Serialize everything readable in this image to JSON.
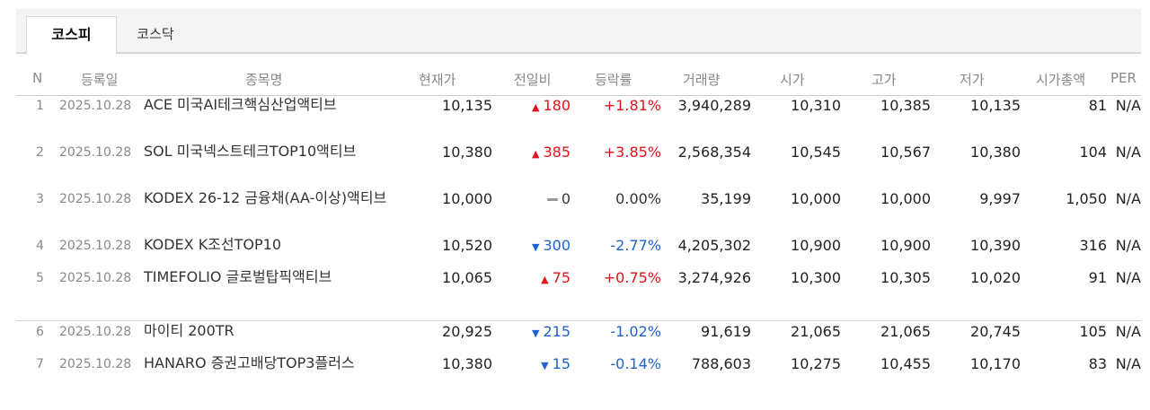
{
  "tabs": [
    {
      "label": "코스피",
      "active": true
    },
    {
      "label": "코스닥",
      "active": false
    }
  ],
  "columns": {
    "no": "N",
    "date": "등록일",
    "name": "종목명",
    "price": "현재가",
    "change": "전일비",
    "rate": "등락률",
    "volume": "거래량",
    "open": "시가",
    "high": "고가",
    "low": "저가",
    "mcap": "시가총액",
    "per": "PER"
  },
  "rows": [
    {
      "no": "1",
      "date": "2025.10.28",
      "name": "ACE 미국AI테크핵심산업액티브",
      "price": "10,135",
      "dir": "up",
      "change": "180",
      "rate": "+1.81%",
      "volume": "3,940,289",
      "open": "10,310",
      "high": "10,385",
      "low": "10,135",
      "mcap": "81",
      "per": "N/A"
    },
    {
      "no": "2",
      "date": "2025.10.28",
      "name": "SOL 미국넥스트테크TOP10액티브",
      "price": "10,380",
      "dir": "up",
      "change": "385",
      "rate": "+3.85%",
      "volume": "2,568,354",
      "open": "10,545",
      "high": "10,567",
      "low": "10,380",
      "mcap": "104",
      "per": "N/A"
    },
    {
      "no": "3",
      "date": "2025.10.28",
      "name": "KODEX 26-12 금융채(AA-이상)액티브",
      "price": "10,000",
      "dir": "flat",
      "change": "0",
      "rate": "0.00%",
      "volume": "35,199",
      "open": "10,000",
      "high": "10,000",
      "low": "9,997",
      "mcap": "1,050",
      "per": "N/A"
    },
    {
      "no": "4",
      "date": "2025.10.28",
      "name": "KODEX K조선TOP10",
      "price": "10,520",
      "dir": "down",
      "change": "300",
      "rate": "-2.77%",
      "volume": "4,205,302",
      "open": "10,900",
      "high": "10,900",
      "low": "10,390",
      "mcap": "316",
      "per": "N/A"
    },
    {
      "no": "5",
      "date": "2025.10.28",
      "name": "TIMEFOLIO 글로벌탑픽액티브",
      "price": "10,065",
      "dir": "up",
      "change": "75",
      "rate": "+0.75%",
      "volume": "3,274,926",
      "open": "10,300",
      "high": "10,305",
      "low": "10,020",
      "mcap": "91",
      "per": "N/A"
    },
    {
      "no": "6",
      "date": "2025.10.28",
      "name": "마이티 200TR",
      "price": "20,925",
      "dir": "down",
      "change": "215",
      "rate": "-1.02%",
      "volume": "91,619",
      "open": "21,065",
      "high": "21,065",
      "low": "20,745",
      "mcap": "105",
      "per": "N/A"
    },
    {
      "no": "7",
      "date": "2025.10.28",
      "name": "HANARO 증권고배당TOP3플러스",
      "price": "10,380",
      "dir": "down",
      "change": "15",
      "rate": "-0.14%",
      "volume": "788,603",
      "open": "10,275",
      "high": "10,455",
      "low": "10,170",
      "mcap": "83",
      "per": "N/A"
    }
  ],
  "colors": {
    "up": "#e0131b",
    "down": "#1e62d0"
  }
}
